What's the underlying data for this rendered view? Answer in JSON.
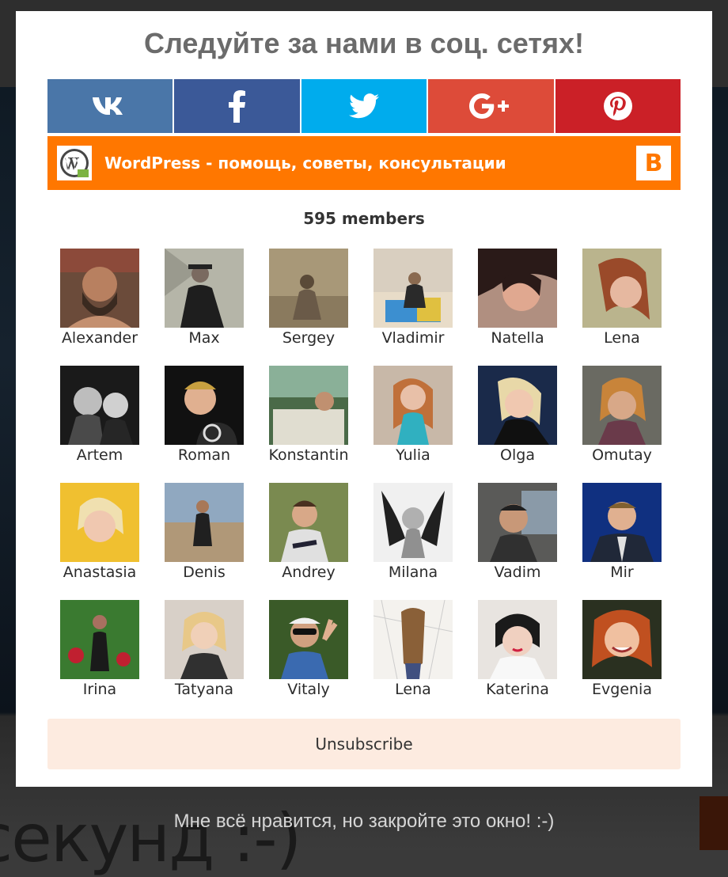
{
  "popup": {
    "title": "Следуйте за нами в соц. сетях!",
    "socials": [
      {
        "name": "vk",
        "icon": "vk-icon",
        "color": "#4a76a8"
      },
      {
        "name": "facebook",
        "icon": "facebook-icon",
        "color": "#3b5998"
      },
      {
        "name": "twitter",
        "icon": "twitter-icon",
        "color": "#00aced"
      },
      {
        "name": "google-plus",
        "icon": "google-plus-icon",
        "color": "#dd4b39"
      },
      {
        "name": "pinterest",
        "icon": "pinterest-icon",
        "color": "#cb2027"
      }
    ],
    "vk_group": {
      "name": "WordPress - помощь, советы, консультации",
      "accent": "#ff7700",
      "button_glyph": "В"
    },
    "members_count": "595 members",
    "members": [
      {
        "name": "Alexander"
      },
      {
        "name": "Max"
      },
      {
        "name": "Sergey"
      },
      {
        "name": "Vladimir"
      },
      {
        "name": "Natella"
      },
      {
        "name": "Lena"
      },
      {
        "name": "Artem"
      },
      {
        "name": "Roman"
      },
      {
        "name": "Konstantin"
      },
      {
        "name": "Yulia"
      },
      {
        "name": "Olga"
      },
      {
        "name": "Omutay"
      },
      {
        "name": "Anastasia"
      },
      {
        "name": "Denis"
      },
      {
        "name": "Andrey"
      },
      {
        "name": "Milana"
      },
      {
        "name": "Vadim"
      },
      {
        "name": "Mir"
      },
      {
        "name": "Irina"
      },
      {
        "name": "Tatyana"
      },
      {
        "name": "Vitaly"
      },
      {
        "name": "Lena"
      },
      {
        "name": "Katerina"
      },
      {
        "name": "Evgenia"
      }
    ],
    "unsubscribe_label": "Unsubscribe"
  },
  "close_link": "Мне всё нравится, но закройте это окно! :-)",
  "background_text": "секунд :-)"
}
